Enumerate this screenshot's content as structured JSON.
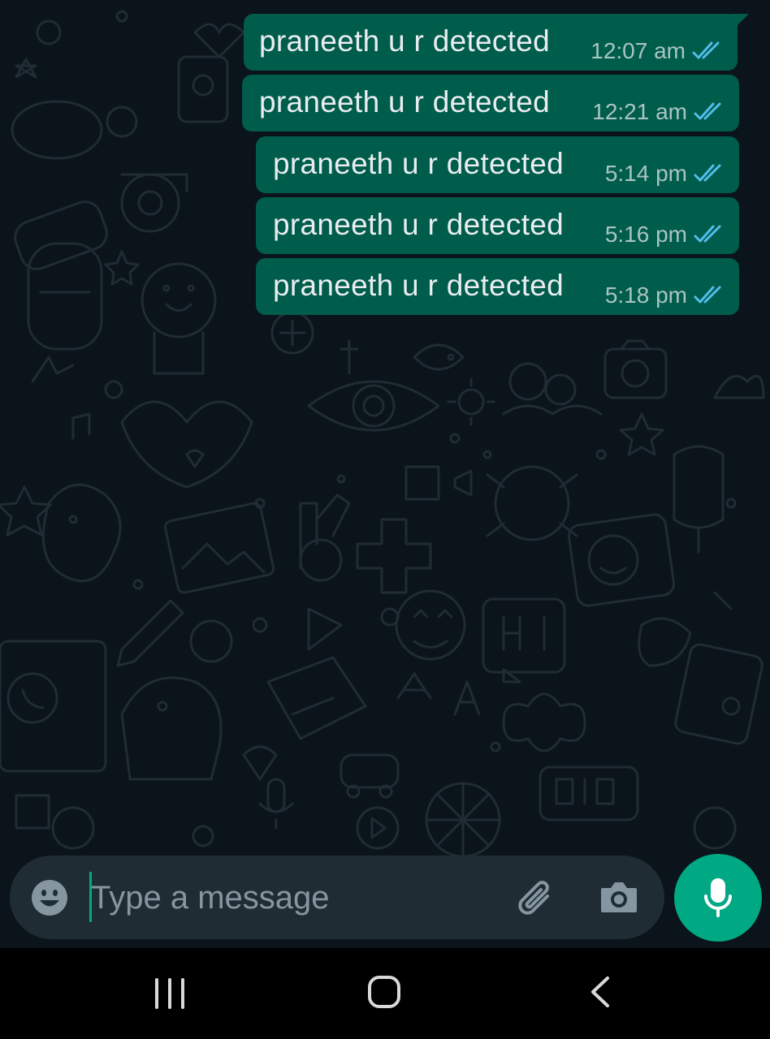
{
  "chat": {
    "messages": [
      {
        "text": "praneeth u r detected",
        "time": "12:07 am",
        "status": "read"
      },
      {
        "text": "praneeth u r detected",
        "time": "12:21 am",
        "status": "read"
      },
      {
        "text": "praneeth u r detected",
        "time": "5:14 pm",
        "status": "read"
      },
      {
        "text": "praneeth u r detected",
        "time": "5:16 pm",
        "status": "read"
      },
      {
        "text": "praneeth u r detected",
        "time": "5:18 pm",
        "status": "read"
      }
    ]
  },
  "composer": {
    "placeholder": "Type a message",
    "value": "",
    "emoji_icon": "emoji-icon",
    "attach_icon": "paperclip-icon",
    "camera_icon": "camera-icon",
    "send_icon": "microphone-icon"
  },
  "navbar": {
    "recents_icon": "recent-apps-icon",
    "home_icon": "home-icon",
    "back_icon": "back-icon"
  },
  "colors": {
    "background": "#0b141a",
    "outgoing_bubble": "#005c4b",
    "input_bar": "#1f2c34",
    "accent": "#00a884",
    "read_ticks": "#53bdeb"
  }
}
